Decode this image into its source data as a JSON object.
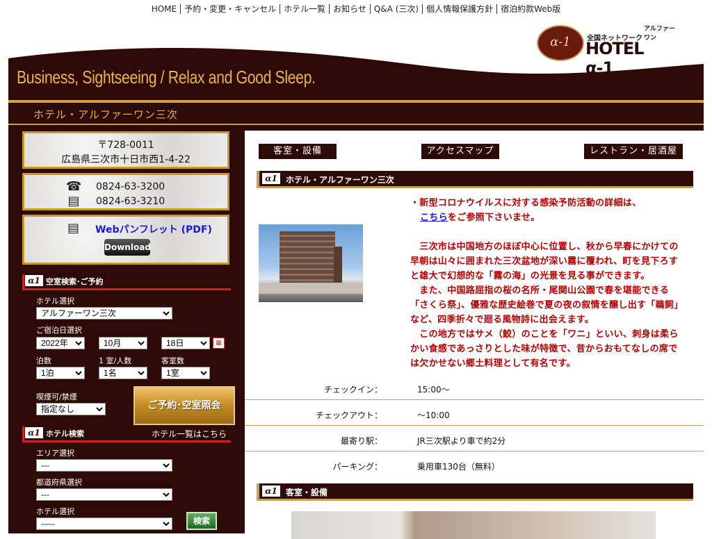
{
  "topnav": [
    "HOME",
    "予約・変更・キャンセル",
    "ホテル一覧",
    "お知らせ",
    "Q&A (三次)",
    "個人情報保護方針",
    "宿泊約款Web版"
  ],
  "logo": {
    "network": "全国ネットワーク",
    "alpha_kana": "アルファーワン",
    "brand": "HOTEL α-1",
    "seal": "α-1"
  },
  "banner": {
    "tagline": "Business, Sightseeing / Relax and Good Sleep.",
    "hotel_name": "ホテル・アルファーワン三次"
  },
  "sidebar": {
    "postal": "〒728-0011",
    "address": "広島県三次市十日市西1-4-22",
    "tel": "0824-63-3200",
    "fax": "0824-63-3210",
    "pamphlet_link": "Webパンフレット (PDF)",
    "download_label": "Download",
    "vacancy_header": "空室検索･ご予約",
    "hotel_select_label": "ホテル選択",
    "hotel_select_value": "アルファーワン三次",
    "checkin_date_label": "ご宿泊日選択",
    "year": "2022年",
    "month": "10月",
    "day": "18日",
    "nights_label": "泊数",
    "nights": "1泊",
    "people_label": "1 室/人数",
    "people": "1名",
    "rooms_label": "客室数",
    "rooms": "1室",
    "smoking_label": "喫煙可/禁煙",
    "smoking": "指定なし",
    "reserve_button": "ご予約･空室照会",
    "hotel_search_header": "ホテル検索",
    "hotel_list_link": "ホテル一覧はこちら",
    "area_label": "エリア選択",
    "area_value": "---",
    "pref_label": "都道府県選択",
    "pref_value": "---",
    "hotel_label2": "ホテル選択",
    "hotel_value2": "-----",
    "search_button": "検索"
  },
  "main": {
    "tabs": [
      "客室・設備",
      "アクセスマップ",
      "レストラン・居酒屋"
    ],
    "section1_title": "ホテル・アルファーワン三次",
    "notice_line1": "・新型コロナウイルスに対する感染予防活動の詳細は、",
    "notice_link": "こちら",
    "notice_line2": "をご参照下さいませ。",
    "description": [
      "　三次市は中国地方のほぼ中心に位置し、秋から早春にかけての早朝は山々に囲まれた三次盆地が深い霧に覆われ、町を見下ろすと雄大で幻想的な「霧の海」の光景を見る事ができます。",
      "　また、中国路屈指の桜の名所・尾関山公園で春を堪能できる「さくら祭」、優雅な歴史絵巻で夏の夜の叙情を醸し出す「鵜飼」など、四季折々で廻る風物詩に出会えます。",
      "　この地方ではサメ（鮫）のことを「ワニ」といい、刺身は柔らかい食感であっさりとした味が特徴で、昔からおもてなしの席では欠かせない郷土料理として有名です。"
    ],
    "info": [
      {
        "key": "チェックイン：",
        "value": "15:00〜"
      },
      {
        "key": "チェックアウト：",
        "value": "〜10:00"
      },
      {
        "key": "最寄り駅：",
        "value": "JR三次駅より車で約2分"
      },
      {
        "key": "パーキング：",
        "value": "乗用車130台（無料）"
      }
    ],
    "section2_title": "客室・設備"
  },
  "colors": {
    "dark_brown": "#2d0a05",
    "gold": "#c8a050",
    "accent_red": "#b80000",
    "link_blue": "#1a1ad8"
  }
}
